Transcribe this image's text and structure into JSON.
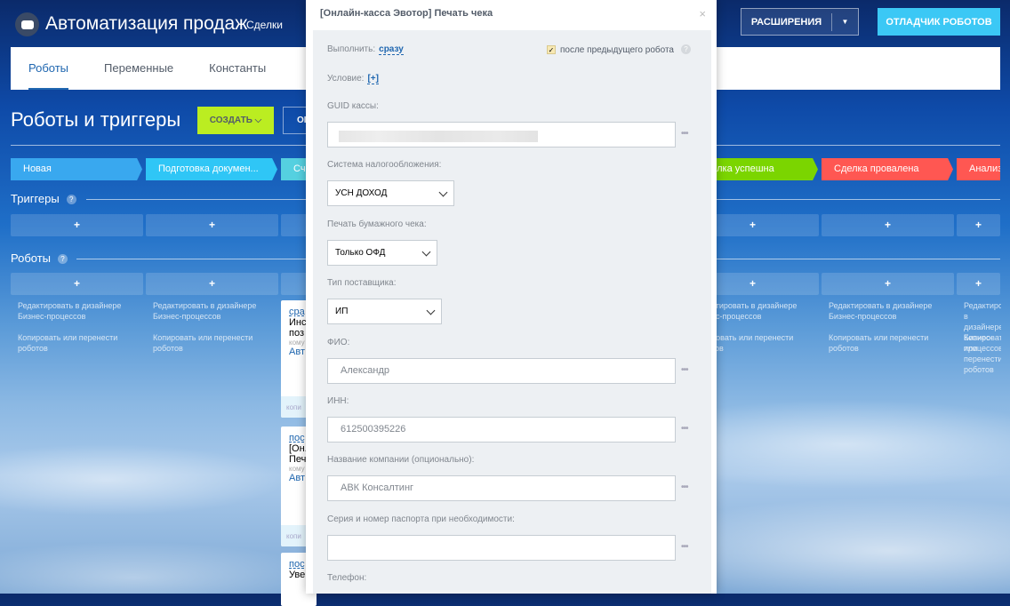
{
  "header": {
    "app_title": "Автоматизация продаж",
    "crm_entity": "Сделки",
    "extensions_button": "РАСШИРЕНИЯ",
    "debugger_button": "ОТЛАДЧИК РОБОТОВ"
  },
  "tabs": [
    {
      "label": "Роботы",
      "active": true
    },
    {
      "label": "Переменные"
    },
    {
      "label": "Константы"
    }
  ],
  "page": {
    "title": "Роботы и триггеры",
    "create_button": "СОЗДАТЬ",
    "other_button": "ОІ"
  },
  "stages": [
    {
      "label": "Новая",
      "color": "#39a8ef"
    },
    {
      "label": "Подготовка докумен...",
      "color": "#2fc6f6"
    },
    {
      "label": "Сч",
      "color": "#55d0e0"
    },
    {
      "label": "",
      "color": "#47e4c2"
    },
    {
      "label": "",
      "color": "#ffa900"
    },
    {
      "label": "Сделка успешна",
      "color": "#7bd500"
    },
    {
      "label": "Сделка провалена",
      "color": "#ff5752"
    },
    {
      "label": "Анализ",
      "color": "#ff5752"
    }
  ],
  "sections": {
    "triggers": "Триггеры",
    "robots": "Роботы",
    "help": "?",
    "add": "+"
  },
  "column_links": {
    "edit": "Редактировать в дизайнере Бизнес-процессов",
    "copy": "Копировать или перенести роботов"
  },
  "robot_cards": [
    {
      "when": "сра",
      "title": "Инс поз",
      "sub": "кому",
      "link": "Авт",
      "footer": "копи"
    },
    {
      "when": "пос",
      "title": "[Он. Печ",
      "sub": "кому",
      "link": "Авт",
      "footer": "копи"
    },
    {
      "when": "пос",
      "title": "Уве"
    }
  ],
  "modal": {
    "title": "[Онлайн-касса Эвотор] Печать чека",
    "close": "×",
    "execute_label": "Выполнить:",
    "execute_value": "сразу",
    "after_previous_label": "после предыдущего робота",
    "after_previous_checked": true,
    "condition_label": "Условие:",
    "condition_add": "[+]",
    "fields": {
      "guid": {
        "label": "GUID кассы:"
      },
      "tax": {
        "label": "Система налогообложения:",
        "value": "УСН ДОХОД"
      },
      "paper": {
        "label": "Печать бумажного чека:",
        "value": "Только ОФД"
      },
      "supplier": {
        "label": "Тип поставщика:",
        "value": "ИП"
      },
      "fio": {
        "label": "ФИО:",
        "value": "Александр"
      },
      "inn": {
        "label": "ИНН:",
        "value": "612500395226"
      },
      "company": {
        "label": "Название компании (опционально):",
        "value": "АВК Консалтинг"
      },
      "passport": {
        "label": "Серия и номер паспорта при необходимости:",
        "value": ""
      },
      "phone": {
        "label": "Телефон:"
      }
    },
    "more": "•••"
  }
}
